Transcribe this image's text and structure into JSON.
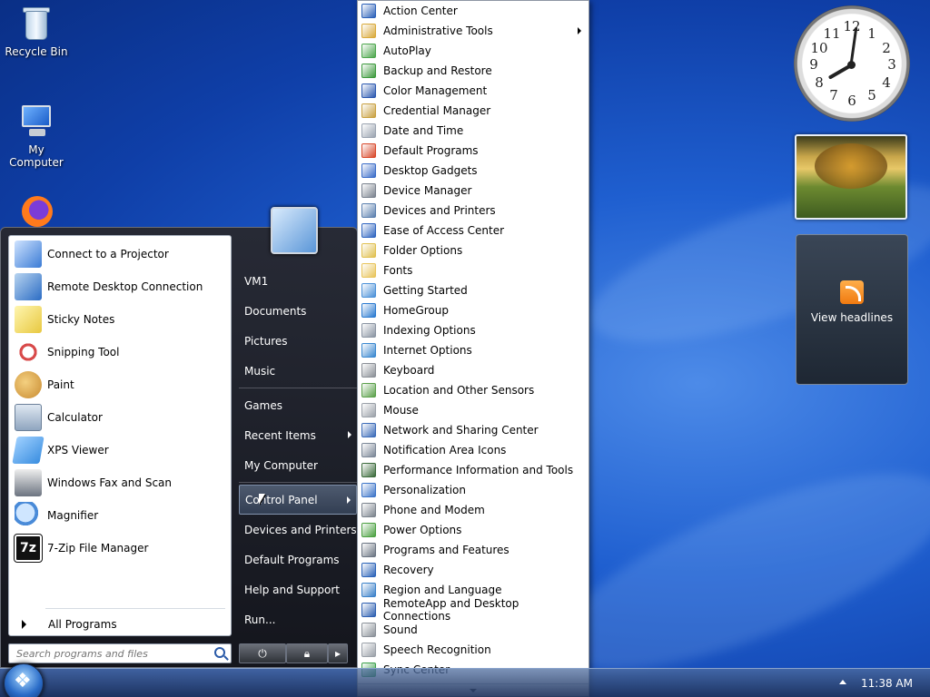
{
  "desktop": {
    "icons": [
      {
        "label": "Recycle Bin"
      },
      {
        "label": "My Computer"
      }
    ]
  },
  "gadgets": {
    "clock_numbers": [
      "12",
      "1",
      "2",
      "3",
      "4",
      "5",
      "6",
      "7",
      "8",
      "9",
      "10",
      "11"
    ],
    "feed_label": "View headlines"
  },
  "start_menu": {
    "programs": [
      {
        "label": "Connect to a Projector",
        "color": "#3a7bd5"
      },
      {
        "label": "Remote Desktop Connection",
        "color": "#2b6cc4"
      },
      {
        "label": "Sticky Notes",
        "color": "#f4e27a"
      },
      {
        "label": "Snipping Tool",
        "color": "#d84a4a"
      },
      {
        "label": "Paint",
        "color": "#e8a13a"
      },
      {
        "label": "Calculator",
        "color": "#8fa5bf"
      },
      {
        "label": "XPS Viewer",
        "color": "#3a8ee0"
      },
      {
        "label": "Windows Fax and Scan",
        "color": "#6c7480"
      },
      {
        "label": "Magnifier",
        "color": "#4a8bd8"
      },
      {
        "label": "7-Zip File Manager",
        "color": "#111111"
      }
    ],
    "all_programs": "All Programs",
    "search_placeholder": "Search programs and files",
    "right_items": [
      {
        "label": "VM1",
        "arrow": false
      },
      {
        "label": "Documents",
        "arrow": false
      },
      {
        "label": "Pictures",
        "arrow": false
      },
      {
        "label": "Music",
        "arrow": false
      },
      {
        "label": "Games",
        "arrow": false
      },
      {
        "label": "Recent Items",
        "arrow": true
      },
      {
        "label": "My Computer",
        "arrow": false
      },
      {
        "label": "Control Panel",
        "arrow": true,
        "active": true
      },
      {
        "label": "Devices and Printers",
        "arrow": false
      },
      {
        "label": "Default Programs",
        "arrow": false
      },
      {
        "label": "Help and Support",
        "arrow": false
      },
      {
        "label": "Run...",
        "arrow": false
      }
    ]
  },
  "control_panel": {
    "items": [
      {
        "label": "Action Center",
        "color": "#2a5fb8"
      },
      {
        "label": "Administrative Tools",
        "color": "#d9a93a",
        "submenu": true
      },
      {
        "label": "AutoPlay",
        "color": "#4ca64c"
      },
      {
        "label": "Backup and Restore",
        "color": "#3d9a3d"
      },
      {
        "label": "Color Management",
        "color": "#2b58b0"
      },
      {
        "label": "Credential Manager",
        "color": "#c8a040"
      },
      {
        "label": "Date and Time",
        "color": "#9aa3b0"
      },
      {
        "label": "Default Programs",
        "color": "#d8482a"
      },
      {
        "label": "Desktop Gadgets",
        "color": "#3a6cc8"
      },
      {
        "label": "Device Manager",
        "color": "#7a828e"
      },
      {
        "label": "Devices and Printers",
        "color": "#5a7fae"
      },
      {
        "label": "Ease of Access Center",
        "color": "#2e64c0"
      },
      {
        "label": "Folder Options",
        "color": "#e0c050"
      },
      {
        "label": "Fonts",
        "color": "#e8c45a"
      },
      {
        "label": "Getting Started",
        "color": "#4a90d8"
      },
      {
        "label": "HomeGroup",
        "color": "#2a7ad0"
      },
      {
        "label": "Indexing Options",
        "color": "#8a94a2"
      },
      {
        "label": "Internet Options",
        "color": "#3a88d0"
      },
      {
        "label": "Keyboard",
        "color": "#8a8f96"
      },
      {
        "label": "Location and Other Sensors",
        "color": "#5aa04a"
      },
      {
        "label": "Mouse",
        "color": "#9aa0a8"
      },
      {
        "label": "Network and Sharing Center",
        "color": "#3a6ab8"
      },
      {
        "label": "Notification Area Icons",
        "color": "#7a8696"
      },
      {
        "label": "Performance Information and Tools",
        "color": "#3a6a3a"
      },
      {
        "label": "Personalization",
        "color": "#3c74c8"
      },
      {
        "label": "Phone and Modem",
        "color": "#7a828c"
      },
      {
        "label": "Power Options",
        "color": "#4aa040"
      },
      {
        "label": "Programs and Features",
        "color": "#6a7482"
      },
      {
        "label": "Recovery",
        "color": "#2a62b8"
      },
      {
        "label": "Region and Language",
        "color": "#3a80c8"
      },
      {
        "label": "RemoteApp and Desktop Connections",
        "color": "#2c5eb0"
      },
      {
        "label": "Sound",
        "color": "#8a9098"
      },
      {
        "label": "Speech Recognition",
        "color": "#9aa0a8"
      },
      {
        "label": "Sync Center",
        "color": "#3aa04a"
      }
    ]
  },
  "taskbar": {
    "time": "11:38 AM"
  }
}
